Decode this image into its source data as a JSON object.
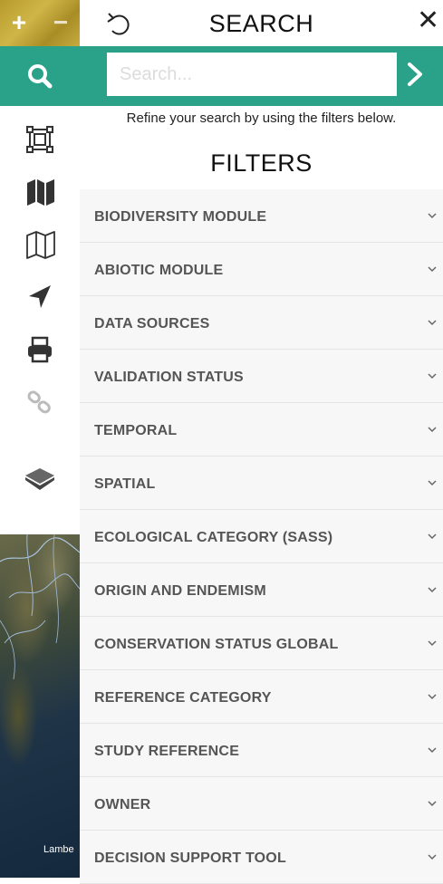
{
  "toolbar": {
    "zoom_in": "+",
    "zoom_out": "−",
    "map_attribution": "Lambe"
  },
  "panel": {
    "title": "SEARCH",
    "search_placeholder": "Search...",
    "hint": "Refine your search by using the filters below.",
    "filters_title": "FILTERS",
    "filters": [
      {
        "label": "BIODIVERSITY MODULE"
      },
      {
        "label": "ABIOTIC MODULE"
      },
      {
        "label": "DATA SOURCES"
      },
      {
        "label": "VALIDATION STATUS"
      },
      {
        "label": "TEMPORAL"
      },
      {
        "label": "SPATIAL"
      },
      {
        "label": "ECOLOGICAL CATEGORY (SASS)"
      },
      {
        "label": "ORIGIN AND ENDEMISM"
      },
      {
        "label": "CONSERVATION STATUS GLOBAL"
      },
      {
        "label": "REFERENCE CATEGORY"
      },
      {
        "label": "STUDY REFERENCE"
      },
      {
        "label": "OWNER"
      },
      {
        "label": "DECISION SUPPORT TOOL"
      }
    ]
  },
  "colors": {
    "accent": "#2aa189",
    "filter_bg": "#f7f7f7",
    "icon": "#333333"
  },
  "icons": [
    "undo-icon",
    "close-icon",
    "search-icon",
    "chevron-right-icon",
    "crop-icon",
    "map-filled-icon",
    "map-outline-icon",
    "location-arrow-icon",
    "print-icon",
    "link-icon",
    "layers-icon",
    "chevron-down-icon"
  ]
}
